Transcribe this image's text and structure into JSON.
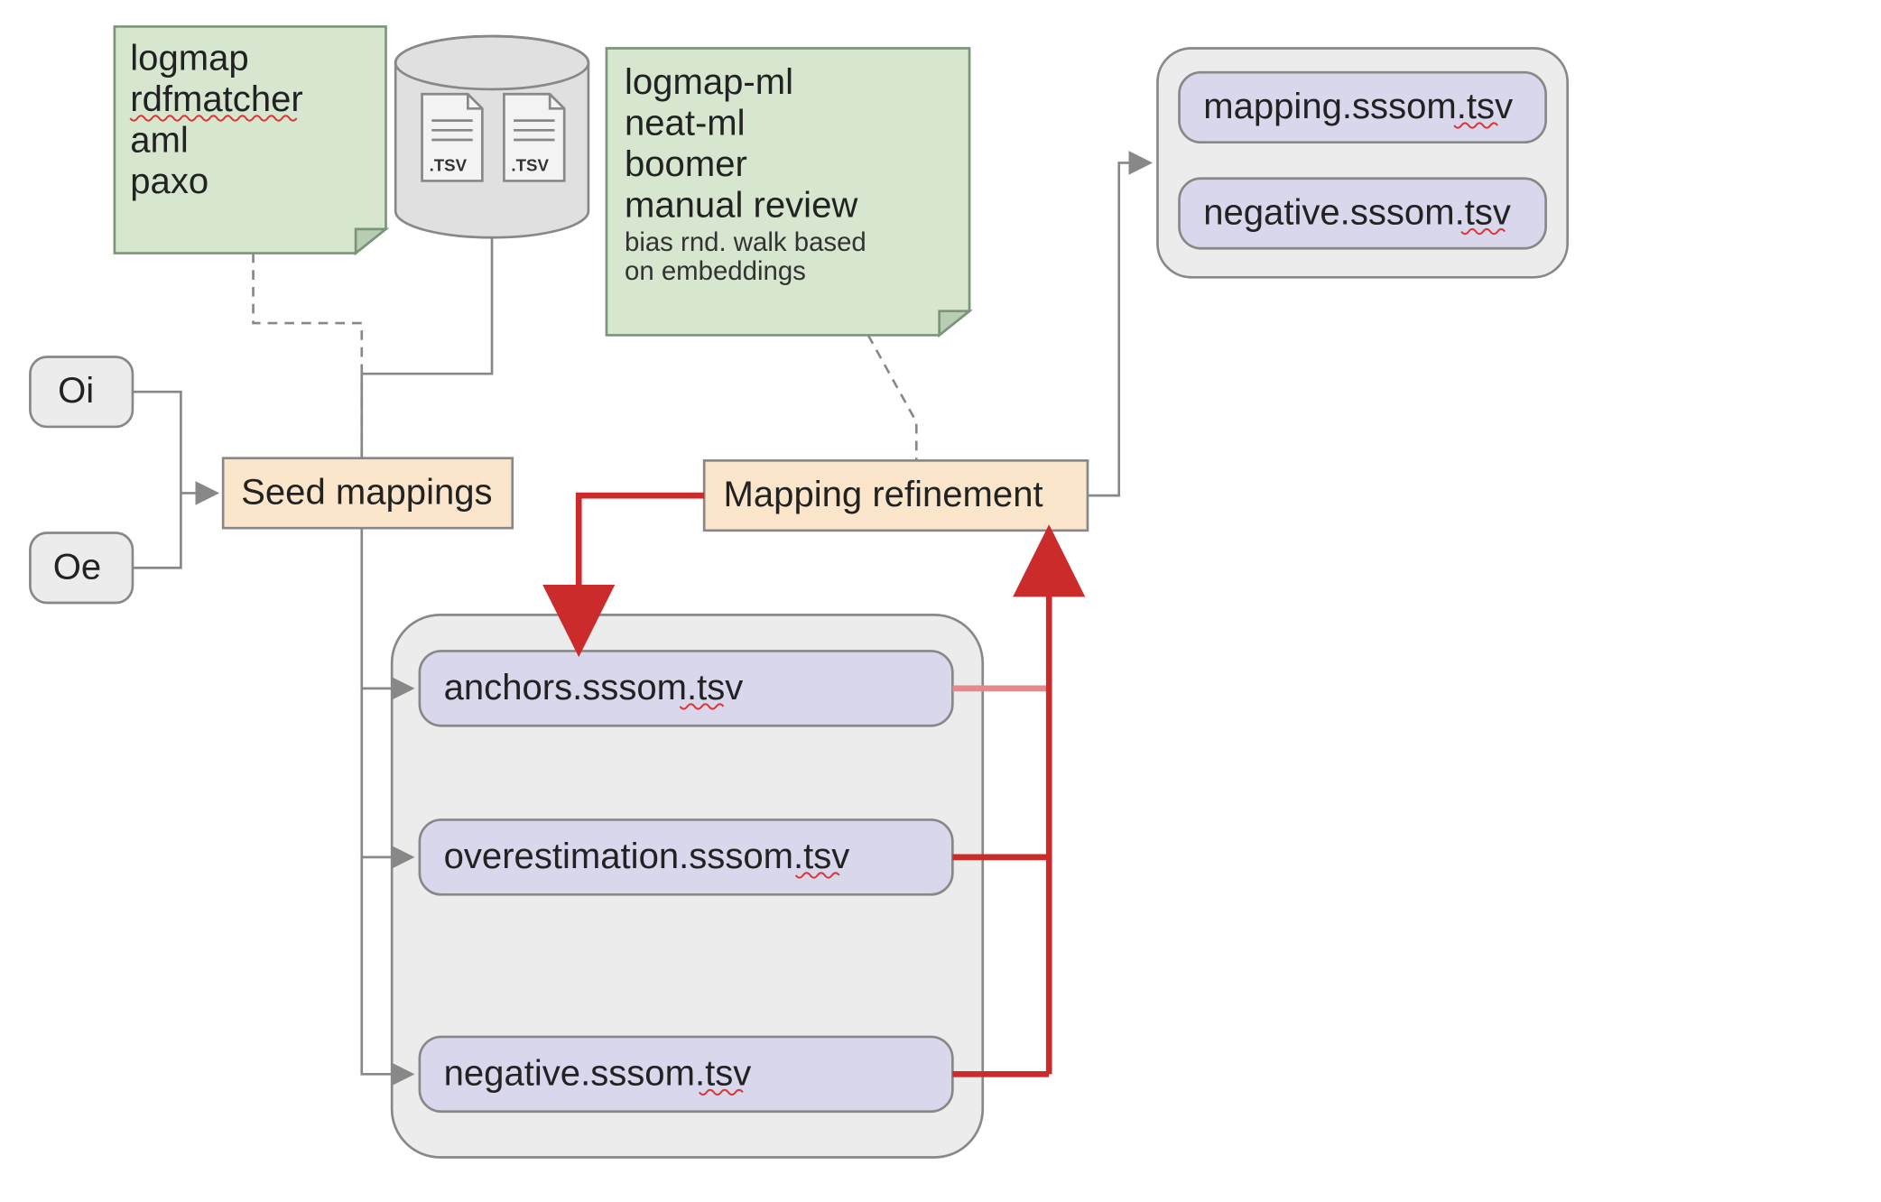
{
  "note_left": {
    "l1": "logmap",
    "l2": "rdfmatcher",
    "l3": "aml",
    "l4": "paxo"
  },
  "note_right": {
    "l1": "logmap-ml",
    "l2": "neat-ml",
    "l3": "boomer",
    "l4": "manual review",
    "s1": "bias rnd. walk based",
    "s2": "on embeddings"
  },
  "ont": {
    "oi": "Oi",
    "oe": "Oe"
  },
  "proc": {
    "seed": "Seed mappings",
    "refine": "Mapping refinement"
  },
  "pool": {
    "anchors": "anchors.sssom.tsv",
    "over": "overestimation.sssom.tsv",
    "neg": "negative.sssom.tsv"
  },
  "out": {
    "map": "mapping.sssom.tsv",
    "neg": "negative.sssom.tsv"
  },
  "db": {
    "ext": ".TSV"
  }
}
